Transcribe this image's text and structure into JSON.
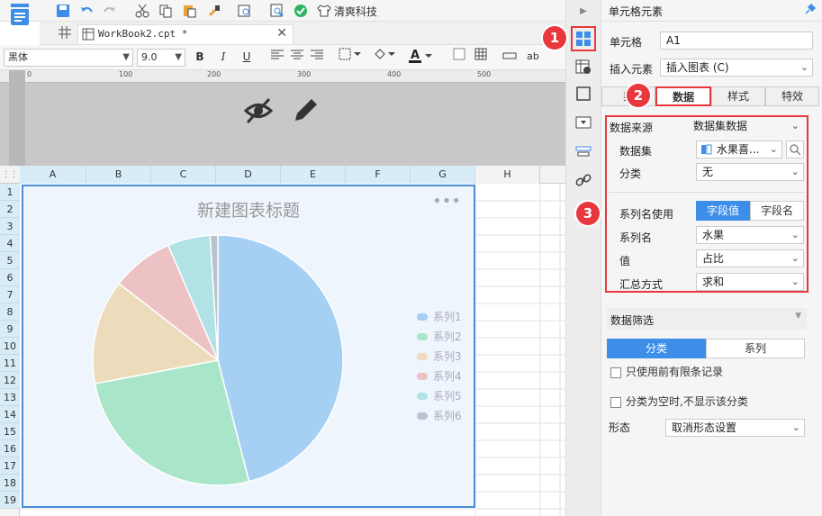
{
  "toolbar": {
    "brand_label": "清爽科技"
  },
  "tab": {
    "title": "WorkBook2.cpt *"
  },
  "format": {
    "font": "黑体",
    "size": "9.0",
    "bold": "B",
    "italic": "I",
    "underline": "U",
    "ab": "ab"
  },
  "ruler": {
    "marks": [
      "0",
      "100",
      "200",
      "300",
      "400",
      "500"
    ]
  },
  "sheet": {
    "columns": [
      "A",
      "B",
      "C",
      "D",
      "E",
      "F",
      "G",
      "H"
    ],
    "rows": [
      "1",
      "2",
      "3",
      "4",
      "5",
      "6",
      "7",
      "8",
      "9",
      "10",
      "11",
      "12",
      "13",
      "14",
      "15",
      "16",
      "17",
      "18",
      "19"
    ]
  },
  "chart_data": {
    "type": "pie",
    "title": "新建图表标题",
    "legend_position": "right",
    "labels": [
      "系列1",
      "系列2",
      "系列3",
      "系列4",
      "系列5",
      "系列6"
    ],
    "values": [
      46,
      26,
      13.5,
      8,
      5.5,
      1
    ],
    "colors": [
      "#a6cff4",
      "#a9e5c9",
      "#ecdcbc",
      "#ecc2c4",
      "#b0e2e6",
      "#b9c3cf"
    ]
  },
  "panel": {
    "title": "单元格元素",
    "cell_label": "单元格",
    "cell_value": "A1",
    "insert_label": "插入元素",
    "insert_value": "插入图表 (C)",
    "tabs": [
      "类",
      "数据",
      "样式",
      "特效"
    ],
    "datasource_label": "数据来源",
    "datasource_value": "数据集数据",
    "dataset_label": "数据集",
    "dataset_value": "水果喜...",
    "category_label": "分类",
    "category_value": "无",
    "series_use_label": "系列名使用",
    "series_use_options": [
      "字段值",
      "字段名"
    ],
    "series_name_label": "系列名",
    "series_name_value": "水果",
    "value_label": "值",
    "value_value": "占比",
    "summary_label": "汇总方式",
    "summary_value": "求和",
    "filter_label": "数据筛选",
    "filter_tabs": [
      "分类",
      "系列"
    ],
    "check1": "只使用前有限条记录",
    "check2": "分类为空时,不显示该分类",
    "shape_label": "形态",
    "shape_value": "取消形态设置"
  },
  "badges": [
    "1",
    "2",
    "3"
  ],
  "accent": "#3d8ee8"
}
